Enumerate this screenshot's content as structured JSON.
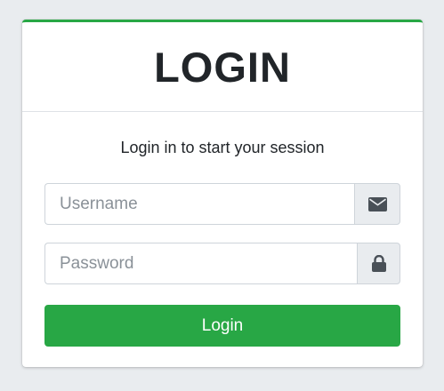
{
  "login": {
    "title": "LOGIN",
    "subtitle": "Login in to start your session",
    "username_placeholder": "Username",
    "username_icon": "envelope-icon",
    "password_placeholder": "Password",
    "password_icon": "lock-icon",
    "button_label": "Login"
  },
  "colors": {
    "accent": "#28a745",
    "background": "#e9ecef",
    "text": "#212529",
    "icon": "#495057"
  }
}
